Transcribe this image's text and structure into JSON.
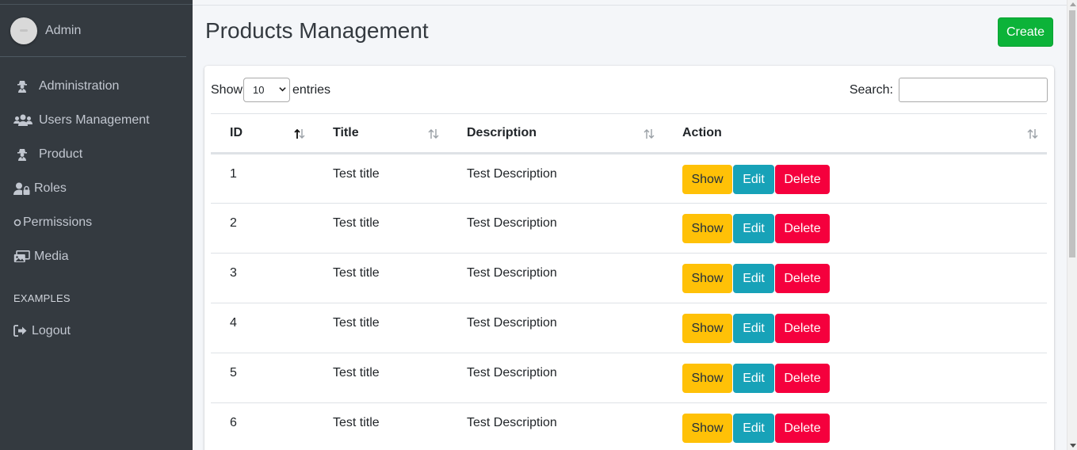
{
  "sidebar": {
    "user_name": "Admin",
    "items": [
      {
        "label": "Administration",
        "icon": "user-secret-icon"
      },
      {
        "label": "Users Management",
        "icon": "users-icon"
      },
      {
        "label": "Product",
        "icon": "user-secret-icon"
      },
      {
        "label": "Roles",
        "icon": "user-lock-icon"
      },
      {
        "label": "Permissions",
        "icon": "circle-icon"
      },
      {
        "label": "Media",
        "icon": "photo-video-icon"
      }
    ],
    "section_header": "EXAMPLES",
    "logout_label": "Logout"
  },
  "header": {
    "title": "Products Management",
    "create_label": "Create"
  },
  "datatable": {
    "show_label": "Show",
    "length_value": "10",
    "entries_label": "entries",
    "search_label": "Search:",
    "search_value": "",
    "columns": [
      "ID",
      "Title",
      "Description",
      "Action"
    ],
    "sorted_column": "ID",
    "rows": [
      {
        "id": "1",
        "title": "Test title",
        "description": "Test Description"
      },
      {
        "id": "2",
        "title": "Test title",
        "description": "Test Description"
      },
      {
        "id": "3",
        "title": "Test title",
        "description": "Test Description"
      },
      {
        "id": "4",
        "title": "Test title",
        "description": "Test Description"
      },
      {
        "id": "5",
        "title": "Test title",
        "description": "Test Description"
      },
      {
        "id": "6",
        "title": "Test title",
        "description": "Test Description"
      }
    ],
    "actions": {
      "show": "Show",
      "edit": "Edit",
      "delete": "Delete"
    }
  },
  "colors": {
    "sidebar_bg": "#343a40",
    "create": "#0cb339",
    "show": "#ffc107",
    "edit": "#17a2b8",
    "delete": "#f5003d"
  }
}
